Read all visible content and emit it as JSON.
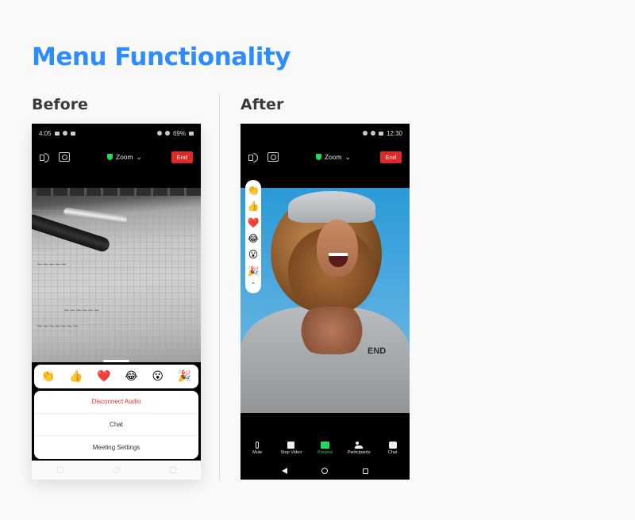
{
  "page": {
    "title": "Menu Functionality",
    "before_label": "Before",
    "after_label": "After"
  },
  "before": {
    "status": {
      "time": "4:05",
      "battery": "69%"
    },
    "meeting_title": "Zoom",
    "end_label": "End",
    "reactions": [
      "👏",
      "👍",
      "❤️",
      "😂",
      "😮",
      "🎉"
    ],
    "menu": [
      "Disconnect Audio",
      "Chat",
      "Meeting Settings"
    ]
  },
  "after": {
    "status": {
      "time": "12:30"
    },
    "meeting_title": "Zoom",
    "end_label": "End",
    "reactions": [
      "👏",
      "👍",
      "❤️",
      "😂",
      "😮",
      "🎉"
    ],
    "toolbar": [
      "Mute",
      "Stop Video",
      "Present",
      "Participants",
      "Chat"
    ],
    "hoodie_text": "END"
  },
  "colors": {
    "accent": "#2d8cff",
    "end_red": "#e02828",
    "present_green": "#23d959",
    "danger": "#d9332c"
  }
}
